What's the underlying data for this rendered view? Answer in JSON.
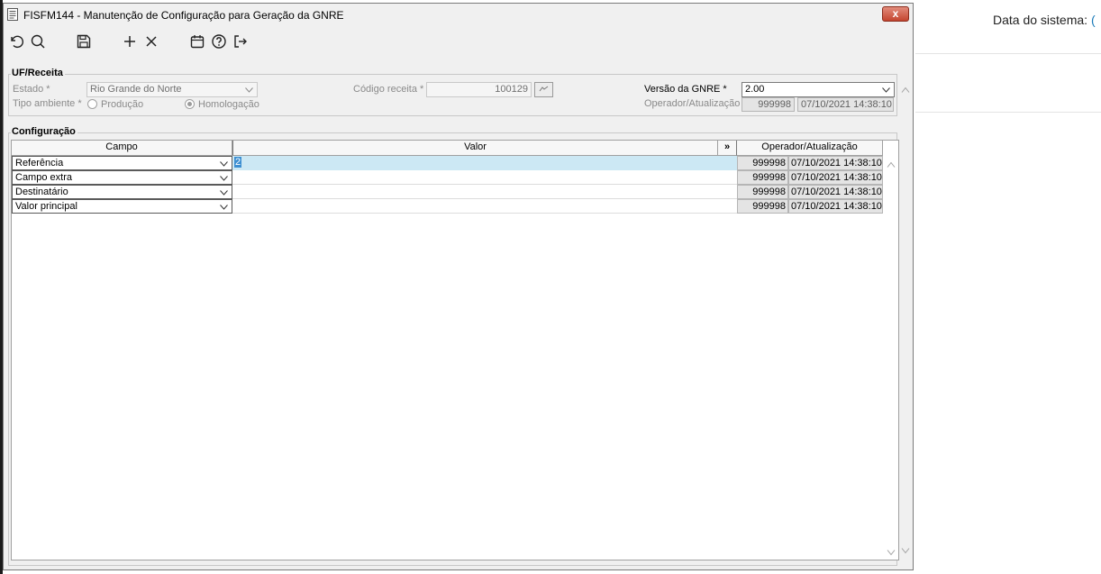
{
  "background": {
    "system_date_label": "Data do sistema:",
    "system_date_accent": "("
  },
  "window": {
    "title": "FISFM144 - Manutenção de Configuração para Geração da GNRE",
    "close": "x"
  },
  "toolbar": {
    "icons": [
      "undo-icon",
      "search-icon",
      "save-icon",
      "add-icon",
      "delete-icon",
      "calendar-icon",
      "help-icon",
      "exit-icon"
    ]
  },
  "uf_group": {
    "title": "UF/Receita",
    "estado_label": "Estado *",
    "estado_value": "Rio Grande do Norte",
    "tipo_ambiente_label": "Tipo ambiente *",
    "producao_label": "Produção",
    "homologacao_label": "Homologação",
    "selected_ambiente": "Homologação",
    "codigo_receita_label": "Código receita *",
    "codigo_receita_value": "100129",
    "versao_label": "Versão da GNRE *",
    "versao_value": "2.00",
    "operador_label": "Operador/Atualização",
    "operador_value": "999998",
    "atualizacao_value": "07/10/2021 14:38:10"
  },
  "config_group": {
    "title": "Configuração",
    "columns": {
      "campo": "Campo",
      "valor": "Valor",
      "expand": "»",
      "operador": "Operador/Atualização"
    },
    "rows": [
      {
        "campo": "Referência",
        "valor": "2",
        "operador": "999998",
        "atualizacao": "07/10/2021 14:38:10"
      },
      {
        "campo": "Campo extra",
        "valor": "",
        "operador": "999998",
        "atualizacao": "07/10/2021 14:38:10"
      },
      {
        "campo": "Destinatário",
        "valor": "",
        "operador": "999998",
        "atualizacao": "07/10/2021 14:38:10"
      },
      {
        "campo": "Valor principal",
        "valor": "",
        "operador": "999998",
        "atualizacao": "07/10/2021 14:38:10"
      }
    ]
  },
  "colors": {
    "selection": "#cce8f4",
    "close_button": "#c4452f",
    "accent": "#1a7ab8"
  }
}
